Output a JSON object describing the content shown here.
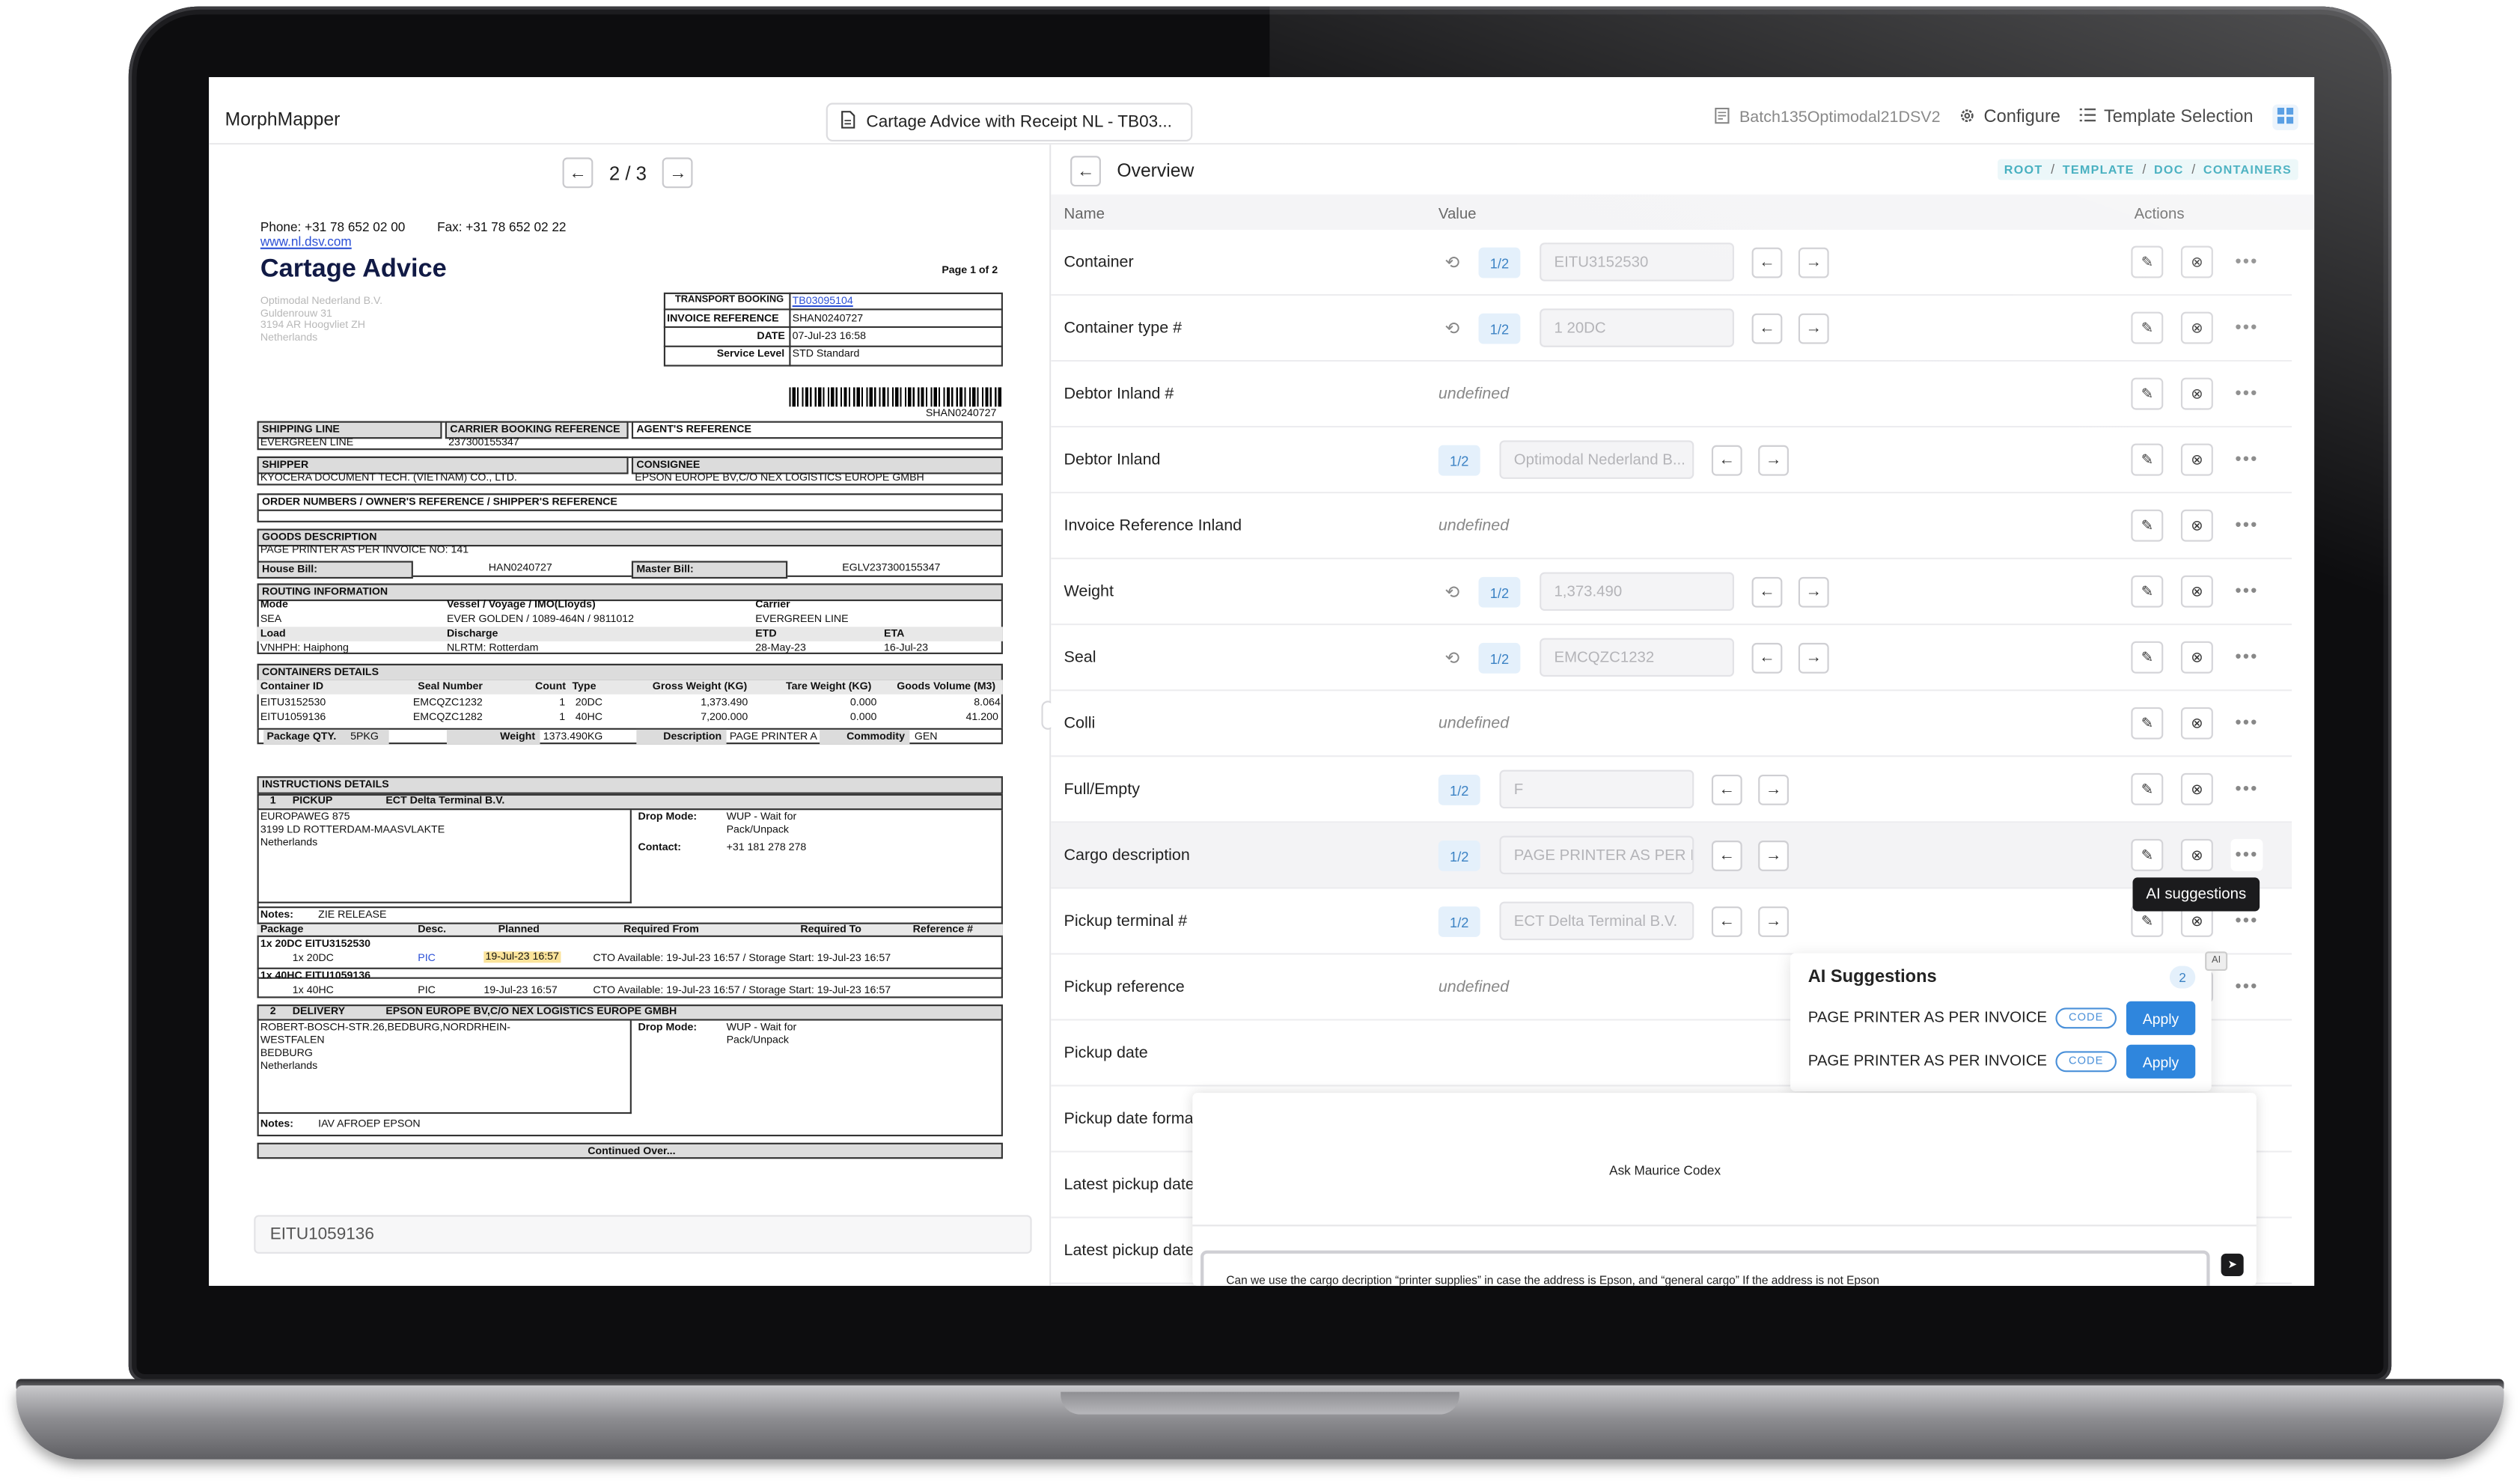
{
  "app": {
    "name": "MorphMapper"
  },
  "topbar": {
    "doc_title": "Cartage Advice with Receipt NL - TB03...",
    "batch": "Batch135Optimodal21DSV2",
    "configure": "Configure",
    "template_selection": "Template Selection"
  },
  "pager": {
    "current": "2 / 3"
  },
  "document": {
    "phone": "Phone: +31 78 652 02 00",
    "fax": "Fax: +31 78 652 02 22",
    "website": "www.nl.dsv.com",
    "title": "Cartage Advice",
    "page": "Page 1 of 2",
    "addr": [
      "Optimodal Nederland B.V.",
      "Guldenrouw 31",
      "3194 AR Hoogvliet ZH",
      "Netherlands"
    ],
    "transport_booking_label": "TRANSPORT BOOKING",
    "transport_booking": "TB03095104",
    "invoice_reference_label": "INVOICE REFERENCE",
    "invoice_reference": "SHAN0240727",
    "date_label": "DATE",
    "date": "07-Jul-23 16:58",
    "service_level_label": "Service Level",
    "service_level": "STD  Standard",
    "barcode_text": "SHAN0240727",
    "shipping_line_label": "SHIPPING LINE",
    "shipping_line": "EVERGREEN LINE",
    "carrier_booking_label": "CARRIER BOOKING REFERENCE",
    "carrier_booking": "237300155347",
    "agents_reference_label": "AGENT'S REFERENCE",
    "shipper_label": "SHIPPER",
    "shipper": "KYOCERA DOCUMENT TECH. (VIETNAM) CO., LTD.",
    "consignee_label": "CONSIGNEE",
    "consignee": "EPSON EUROPE BV,C/O NEX LOGISTICS EUROPE GMBH",
    "order_numbers_label": "ORDER NUMBERS / OWNER'S REFERENCE / SHIPPER'S REFERENCE",
    "goods_label": "GOODS DESCRIPTION",
    "goods": "PAGE PRINTER AS PER INVOICE NO: 141",
    "house_bill_label": "House Bill:",
    "house_bill": "HAN0240727",
    "master_bill_label": "Master Bill:",
    "master_bill": "EGLV237300155347",
    "routing_label": "ROUTING INFORMATION",
    "mode_label": "Mode",
    "mode": "SEA",
    "vessel_label": "Vessel / Voyage / IMO(Lloyds)",
    "vessel": "EVER GOLDEN / 1089-464N / 9811012",
    "carrier_label": "Carrier",
    "carrier": "EVERGREEN LINE",
    "load_label": "Load",
    "load": "VNHPH: Haiphong",
    "discharge_label": "Discharge",
    "discharge": "NLRTM: Rotterdam",
    "etd_label": "ETD",
    "etd": "28-May-23",
    "eta_label": "ETA",
    "eta": "16-Jul-23",
    "containers_label": "CONTAINERS DETAILS",
    "container_headers": [
      "Container ID",
      "Seal Number",
      "Count",
      "Type",
      "Gross Weight (KG)",
      "Tare Weight (KG)",
      "Goods Volume (M3)"
    ],
    "containers": [
      [
        "EITU3152530",
        "EMCQZC1232",
        "1",
        "20DC",
        "1,373.490",
        "0.000",
        "8.064"
      ],
      [
        "EITU1059136",
        "EMCQZC1282",
        "1",
        "40HC",
        "7,200.000",
        "0.000",
        "41.200"
      ]
    ],
    "package_qty_label": "Package QTY.",
    "package_qty": "5PKG",
    "weight_label": "Weight",
    "weight": "1373.490KG",
    "description_label": "Description",
    "description": "PAGE PRINTER A",
    "commodity_label": "Commodity",
    "commodity": "GEN",
    "instructions_label": "INSTRUCTIONS DETAILS",
    "pickup_num": "1",
    "pickup_label": "PICKUP",
    "pickup_name": "ECT Delta Terminal B.V.",
    "pickup_addr": [
      "EUROPAWEG 875",
      "3199 LD ROTTERDAM-MAASVLAKTE",
      "Netherlands"
    ],
    "drop_mode_label": "Drop Mode:",
    "drop_mode": [
      "WUP - Wait for",
      "Pack/Unpack"
    ],
    "contact_label": "Contact:",
    "contact": "+31 181 278 278",
    "notes_label": "Notes:",
    "pickup_notes": "ZIE RELEASE",
    "pkg_headers": [
      "Package",
      "Desc.",
      "Planned",
      "Required From",
      "Required To",
      "Reference #"
    ],
    "pkg1_title": "1x 20DC EITU3152530",
    "pkg1_type": "1x 20DC",
    "pkg1_desc": "PIC",
    "pkg1_planned": "19-Jul-23 16:57",
    "pkg1_req": "CTO Available: 19-Jul-23 16:57 / Storage Start: 19-Jul-23 16:57",
    "pkg2_title": "1x 40HC EITU1059136",
    "pkg2_type": "1x 40HC",
    "pkg2_desc": "PIC",
    "pkg2_planned": "19-Jul-23 16:57",
    "pkg2_req": "CTO Available: 19-Jul-23 16:57 / Storage Start: 19-Jul-23 16:57",
    "delivery_num": "2",
    "delivery_label": "DELIVERY",
    "delivery_name": "EPSON EUROPE BV,C/O NEX LOGISTICS EUROPE GMBH",
    "delivery_addr": [
      "ROBERT-BOSCH-STR.26,BEDBURG,NORDRHEIN-",
      "WESTFALEN",
      "BEDBURG",
      "Netherlands"
    ],
    "delivery_notes": "IAV AFROEP EPSON",
    "continued": "Continued Over..."
  },
  "bottom_input": "EITU1059136",
  "overview": {
    "title": "Overview",
    "crumbs": [
      "ROOT",
      "TEMPLATE",
      "DOC",
      "CONTAINERS"
    ],
    "col_name": "Name",
    "col_value": "Value",
    "col_actions": "Actions"
  },
  "rows": [
    {
      "label": "Container",
      "badge": "1/2",
      "value": "EITU3152530"
    },
    {
      "label": "Container type #",
      "badge": "1/2",
      "value": "1 20DC"
    },
    {
      "label": "Debtor Inland #",
      "undefined": "undefined"
    },
    {
      "label": "Debtor Inland",
      "badge": "1/2",
      "value": "Optimodal Nederland B..."
    },
    {
      "label": "Invoice Reference Inland",
      "undefined": "undefined"
    },
    {
      "label": "Weight",
      "badge": "1/2",
      "value": "1,373.490"
    },
    {
      "label": "Seal",
      "badge": "1/2",
      "value": "EMCQZC1232"
    },
    {
      "label": "Colli",
      "undefined": "undefined"
    },
    {
      "label": "Full/Empty",
      "badge": "1/2",
      "value": "F"
    },
    {
      "label": "Cargo description",
      "badge": "1/2",
      "value": "PAGE PRINTER AS PER I"
    },
    {
      "label": "Pickup terminal #",
      "badge": "1/2",
      "value": "ECT Delta Terminal B.V."
    },
    {
      "label": "Pickup reference",
      "undefined": "undefined"
    },
    {
      "label": "Pickup date"
    },
    {
      "label": "Pickup date forma"
    },
    {
      "label": "Latest pickup date"
    },
    {
      "label": "Latest pickup date"
    }
  ],
  "tooltip": "AI suggestions",
  "ai_tag": "AI",
  "ai_panel": {
    "title": "AI Suggestions",
    "count": "2",
    "items": [
      {
        "text": "PAGE PRINTER AS PER INVOICE N",
        "code": "CODE",
        "apply": "Apply"
      },
      {
        "text": "PAGE PRINTER AS PER INVOICE N",
        "code": "CODE",
        "apply": "Apply"
      }
    ]
  },
  "chat": {
    "title": "Ask Maurice Codex",
    "message": "Can we use the cargo decription “printer supplies” in case the address is Epson, and “general cargo” If the address is not Epson"
  }
}
